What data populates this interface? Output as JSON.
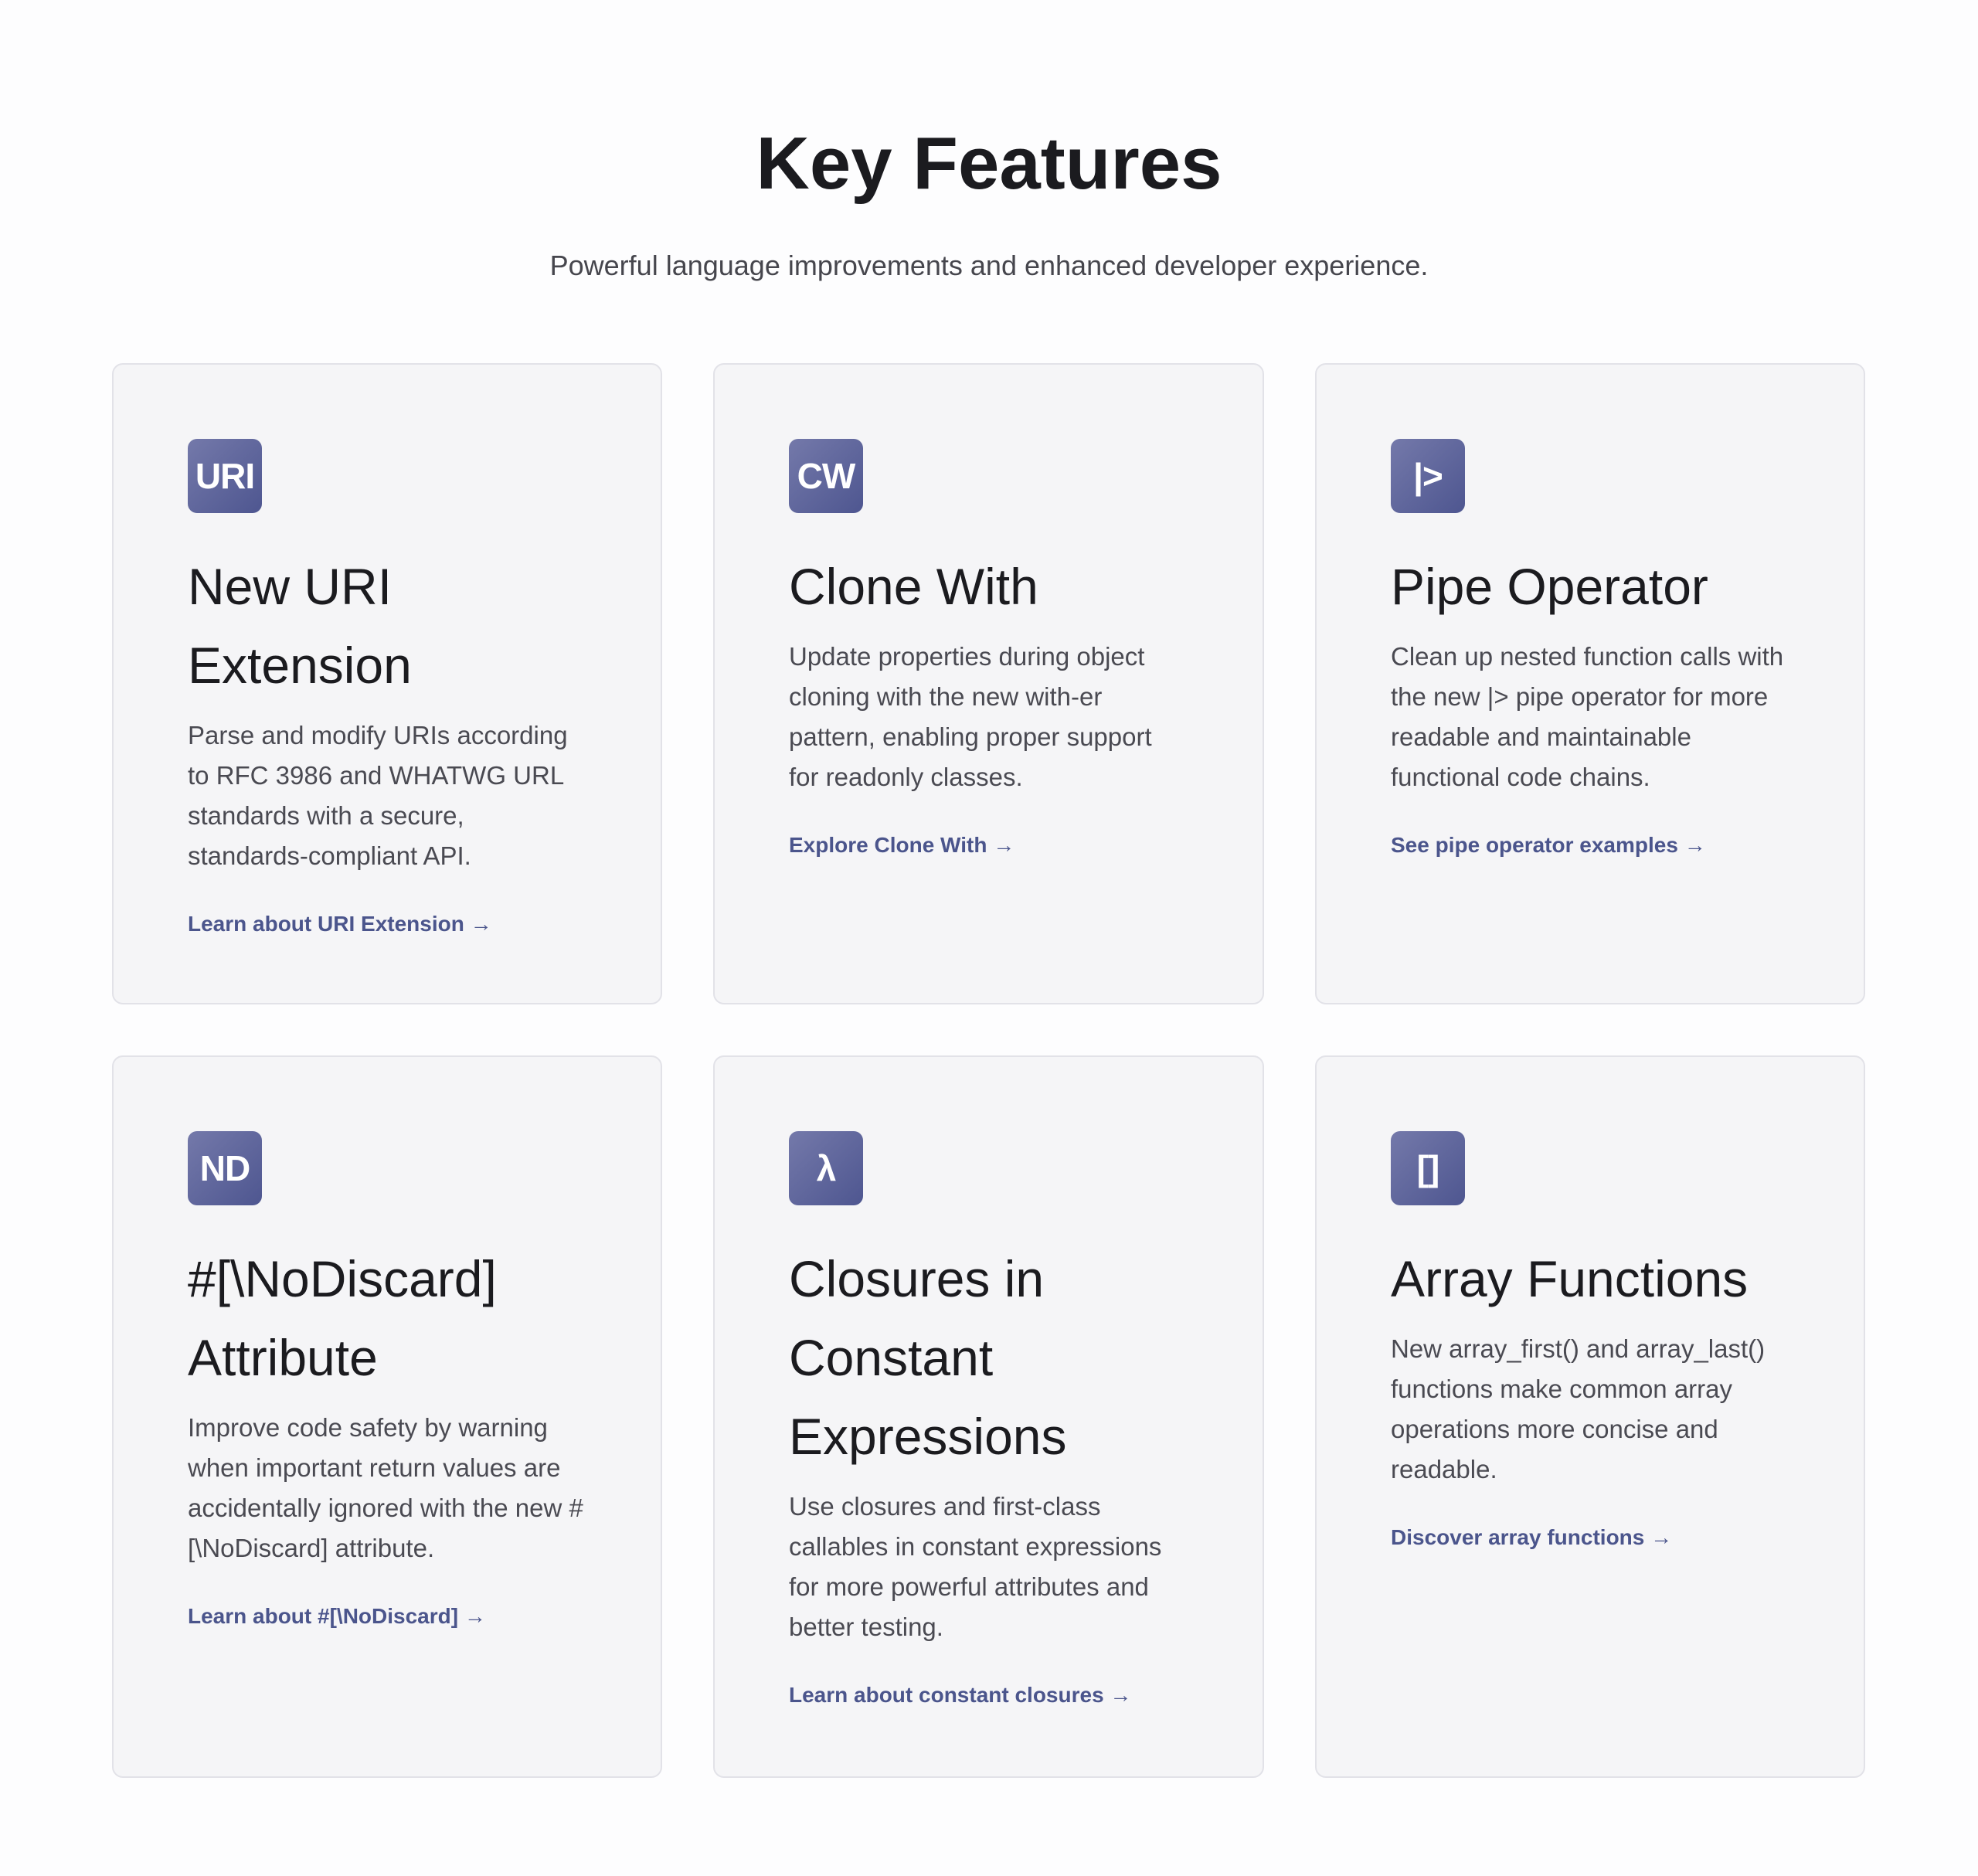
{
  "header": {
    "title": "Key Features",
    "subtitle": "Powerful language improvements and enhanced developer experience."
  },
  "features": [
    {
      "icon": "URI",
      "title": "New URI Extension",
      "description": "Parse and modify URIs according to RFC 3986 and WHATWG URL standards with a secure, standards-compliant API.",
      "link": "Learn about URI Extension →"
    },
    {
      "icon": "CW",
      "title": "Clone With",
      "description": "Update properties during object cloning with the new with-er pattern, enabling proper support for readonly classes.",
      "link": "Explore Clone With →"
    },
    {
      "icon": "|>",
      "title": "Pipe Operator",
      "description": "Clean up nested function calls with the new |> pipe operator for more readable and maintainable functional code chains.",
      "link": "See pipe operator examples →"
    },
    {
      "icon": "ND",
      "title": "#[\\NoDiscard] Attribute",
      "description": "Improve code safety by warning when important return values are accidentally ignored with the new #[\\NoDiscard] attribute.",
      "link": "Learn about #[\\NoDiscard] →"
    },
    {
      "icon": "λ",
      "title": "Closures in Constant Expressions",
      "description": "Use closures and first-class callables in constant expressions for more powerful attributes and better testing.",
      "link": "Learn about constant closures →"
    },
    {
      "icon": "[]",
      "title": "Array Functions",
      "description": "New array_first() and array_last() functions make common array operations more concise and readable.",
      "link": "Discover array functions →"
    }
  ],
  "colors": {
    "icon_gradient_start": "#7479aa",
    "icon_gradient_end": "#4e5690",
    "link": "#4b558c",
    "card_background": "#f5f5f7"
  }
}
